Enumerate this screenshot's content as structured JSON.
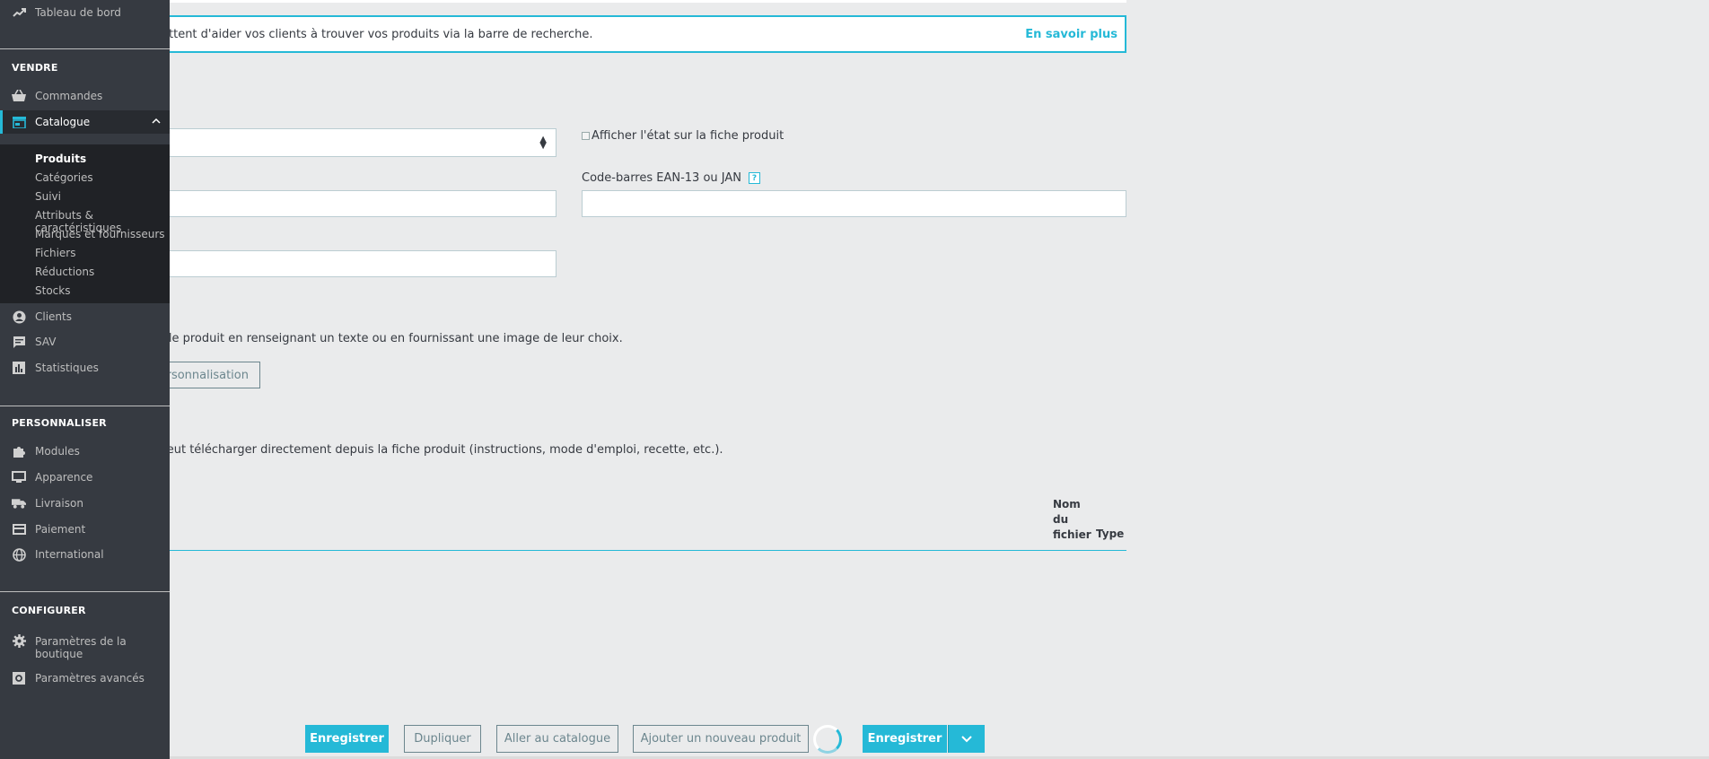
{
  "banner": {
    "text": "ttent d'aider vos clients à trouver vos produits via la barre de recherche.",
    "link": "En savoir plus"
  },
  "form": {
    "condition_checkbox_label": "Afficher l'état sur la fiche produit",
    "ean_label": "Code-barres EAN-13 ou JAN",
    "help_glyph": "?",
    "customization_desc": "iser le produit en renseignant un texte ou en fournissant une image de leur choix.",
    "customization_button": "ersonnalisation",
    "attachments_desc": "nt peut télécharger directement depuis la fiche produit (instructions, mode d'emploi, recette, etc.).",
    "table_columns": [
      "Nom du fichier",
      "Type"
    ]
  },
  "footer": {
    "save": "Enregistrer",
    "duplicate": "Dupliquer",
    "go_catalog": "Aller au catalogue",
    "add_new": "Ajouter un nouveau produit",
    "save_primary": "Enregistrer"
  },
  "sidebar": {
    "dashboard": "Tableau de bord",
    "sections": {
      "sell": "VENDRE",
      "customize": "PERSONNALISER",
      "configure": "CONFIGURER"
    },
    "sell_items": [
      "Commandes",
      "Catalogue"
    ],
    "catalog_sub": [
      "Produits",
      "Catégories",
      "Suivi",
      "Attributs & caractéristiques",
      "Marques et fournisseurs",
      "Fichiers",
      "Réductions",
      "Stocks"
    ],
    "sell_items_after": [
      "Clients",
      "SAV",
      "Statistiques"
    ],
    "customize_items": [
      "Modules",
      "Apparence",
      "Livraison",
      "Paiement",
      "International"
    ],
    "configure_items": [
      "Paramètres de la boutique",
      "Paramètres avancés"
    ]
  },
  "colors": {
    "accent": "#25b9d7",
    "sidebar_bg": "#363a41",
    "submenu_bg": "#202226"
  }
}
